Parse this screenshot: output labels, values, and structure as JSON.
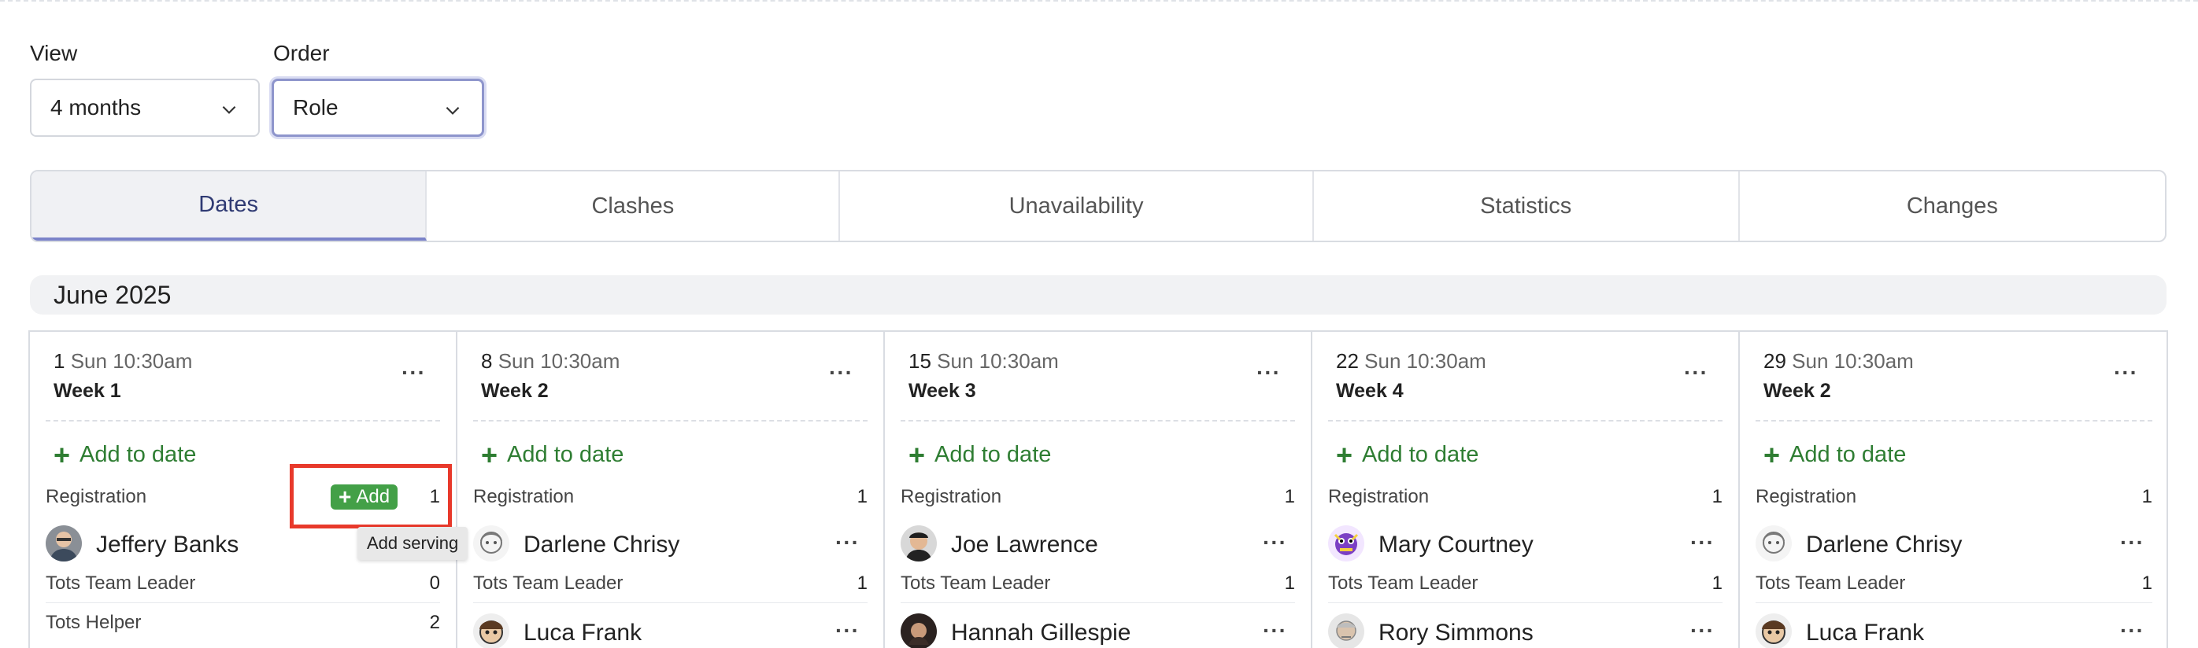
{
  "view": {
    "label": "View",
    "value": "4 months"
  },
  "order": {
    "label": "Order",
    "value": "Role"
  },
  "tabs": [
    {
      "label": "Dates",
      "active": true
    },
    {
      "label": "Clashes",
      "active": false
    },
    {
      "label": "Unavailability",
      "active": false
    },
    {
      "label": "Statistics",
      "active": false
    },
    {
      "label": "Changes",
      "active": false
    }
  ],
  "month": "June 2025",
  "add_to_date_label": "Add to date",
  "add_chip_label": "Add",
  "tooltip": "Add serving",
  "columns": [
    {
      "day": "1",
      "time": "Sun 10:30am",
      "week": "Week 1",
      "roles": [
        {
          "name": "Registration",
          "count": "1"
        },
        {
          "name": "Tots Team Leader",
          "count": "0"
        },
        {
          "name": "Tots Helper",
          "count": "2"
        }
      ],
      "people": [
        {
          "name": "Jeffery Banks",
          "avatar": "man-glasses"
        }
      ]
    },
    {
      "day": "8",
      "time": "Sun 10:30am",
      "week": "Week 2",
      "roles": [
        {
          "name": "Registration",
          "count": "1"
        },
        {
          "name": "Tots Team Leader",
          "count": "1"
        }
      ],
      "people": [
        {
          "name": "Darlene Chrisy",
          "avatar": "sketch-face"
        },
        {
          "name": "Luca Frank",
          "avatar": "cartoon-face"
        }
      ]
    },
    {
      "day": "15",
      "time": "Sun 10:30am",
      "week": "Week 3",
      "roles": [
        {
          "name": "Registration",
          "count": "1"
        },
        {
          "name": "Tots Team Leader",
          "count": "1"
        }
      ],
      "people": [
        {
          "name": "Joe Lawrence",
          "avatar": "man-dark-hair"
        },
        {
          "name": "Hannah Gillespie",
          "avatar": "woman-dark"
        }
      ]
    },
    {
      "day": "22",
      "time": "Sun 10:30am",
      "week": "Week 4",
      "roles": [
        {
          "name": "Registration",
          "count": "1"
        },
        {
          "name": "Tots Team Leader",
          "count": "1"
        }
      ],
      "people": [
        {
          "name": "Mary Courtney",
          "avatar": "purple-character"
        },
        {
          "name": "Rory Simmons",
          "avatar": "old-man"
        }
      ]
    },
    {
      "day": "29",
      "time": "Sun 10:30am",
      "week": "Week 2",
      "roles": [
        {
          "name": "Registration",
          "count": "1"
        },
        {
          "name": "Tots Team Leader",
          "count": "1"
        }
      ],
      "people": [
        {
          "name": "Darlene Chrisy",
          "avatar": "sketch-face"
        },
        {
          "name": "Luca Frank",
          "avatar": "cartoon-face"
        }
      ]
    }
  ]
}
